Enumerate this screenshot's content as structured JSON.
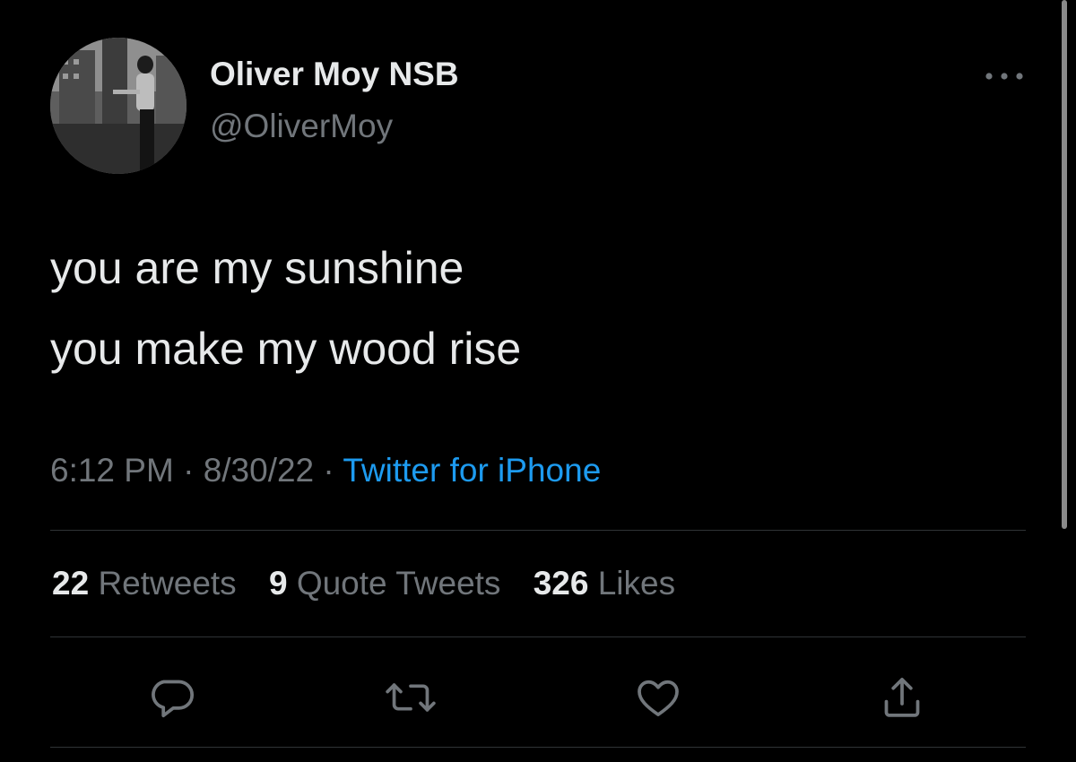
{
  "user": {
    "display_name": "Oliver Moy NSB",
    "handle": "@OliverMoy"
  },
  "tweet": {
    "lines": [
      "you are my sunshine",
      "you make my wood rise"
    ],
    "time": "6:12 PM",
    "separator": " · ",
    "date": "8/30/22",
    "source": "Twitter for iPhone"
  },
  "stats": {
    "retweets_count": "22",
    "retweets_label": "Retweets",
    "quotes_count": "9",
    "quotes_label": "Quote Tweets",
    "likes_count": "326",
    "likes_label": "Likes"
  },
  "icons": {
    "more": "more-dots-icon",
    "reply": "reply-icon",
    "retweet": "retweet-icon",
    "like": "heart-icon",
    "share": "share-icon"
  },
  "colors": {
    "background": "#000000",
    "text": "#e7e9ea",
    "secondary": "#71767b",
    "link": "#1d9bf0",
    "divider": "#2f3336"
  }
}
